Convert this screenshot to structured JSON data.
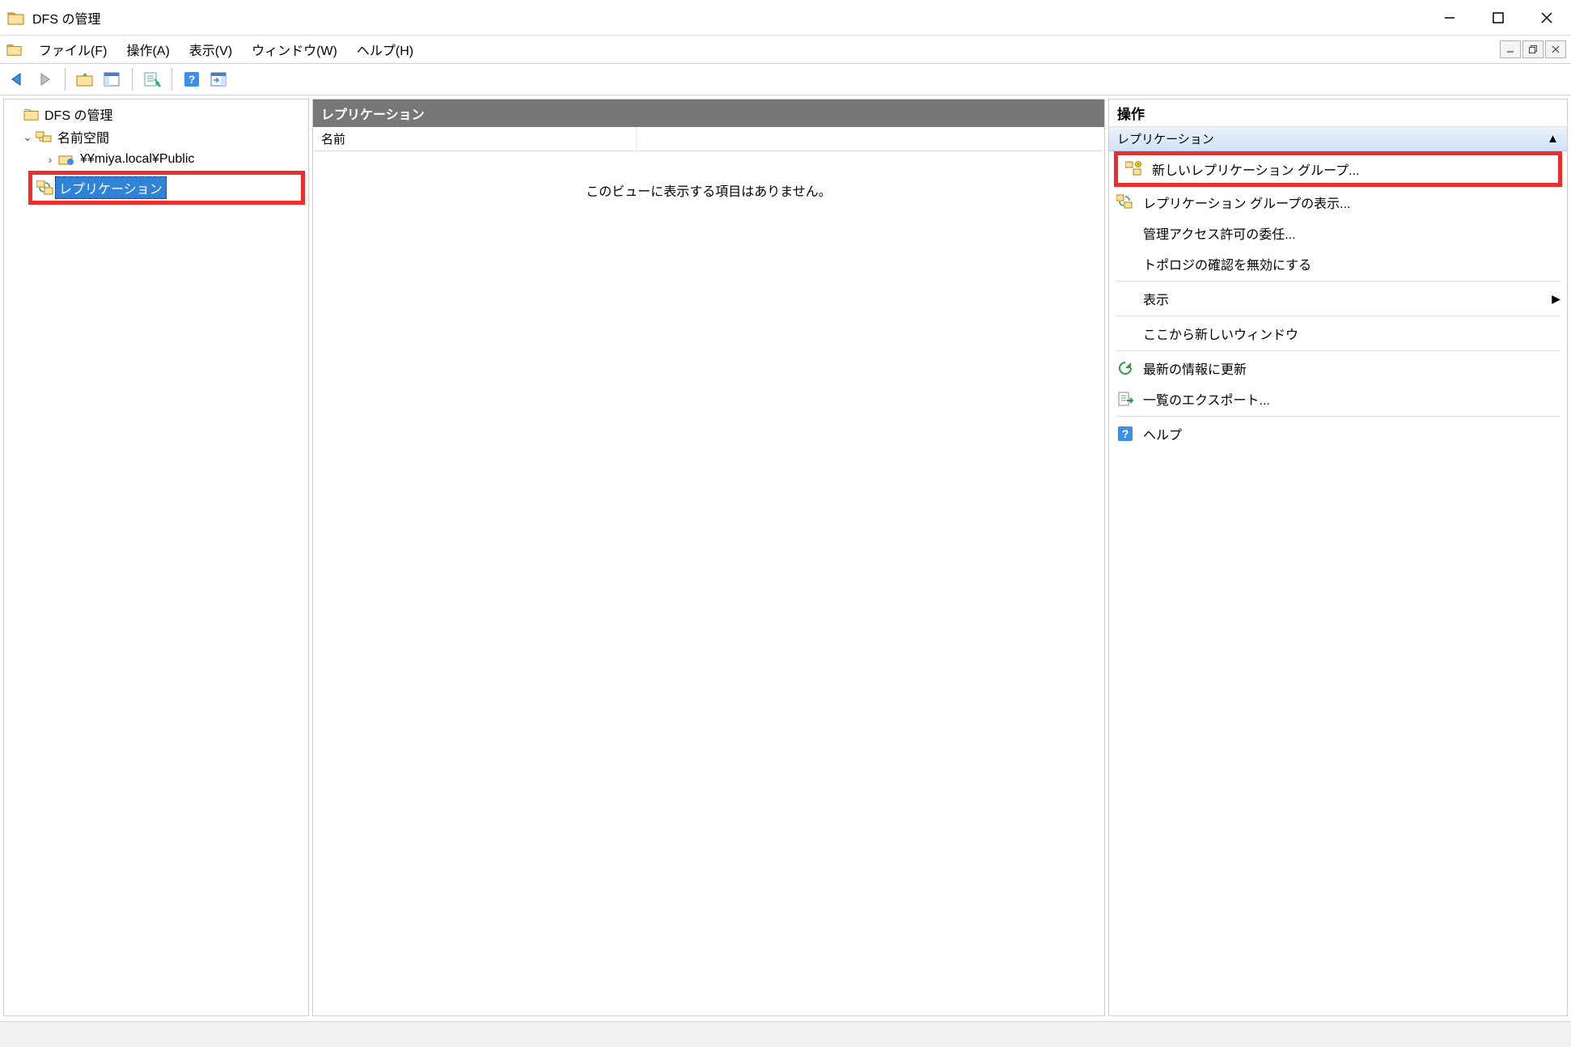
{
  "window": {
    "title": "DFS の管理"
  },
  "menu": {
    "file": "ファイル(F)",
    "action": "操作(A)",
    "view": "表示(V)",
    "window": "ウィンドウ(W)",
    "help": "ヘルプ(H)"
  },
  "tree": {
    "root": "DFS の管理",
    "namespaces": "名前空間",
    "namespace_path": "¥¥miya.local¥Public",
    "replication": "レプリケーション"
  },
  "center": {
    "header": "レプリケーション",
    "column_name": "名前",
    "empty_message": "このビューに表示する項目はありません。"
  },
  "actions": {
    "title": "操作",
    "group_header": "レプリケーション",
    "items": {
      "new_group": "新しいレプリケーション グループ...",
      "show_groups": "レプリケーション グループの表示...",
      "delegate": "管理アクセス許可の委任...",
      "disable_topology": "トポロジの確認を無効にする",
      "view": "表示",
      "new_window": "ここから新しいウィンドウ",
      "refresh": "最新の情報に更新",
      "export_list": "一覧のエクスポート...",
      "help": "ヘルプ"
    }
  }
}
